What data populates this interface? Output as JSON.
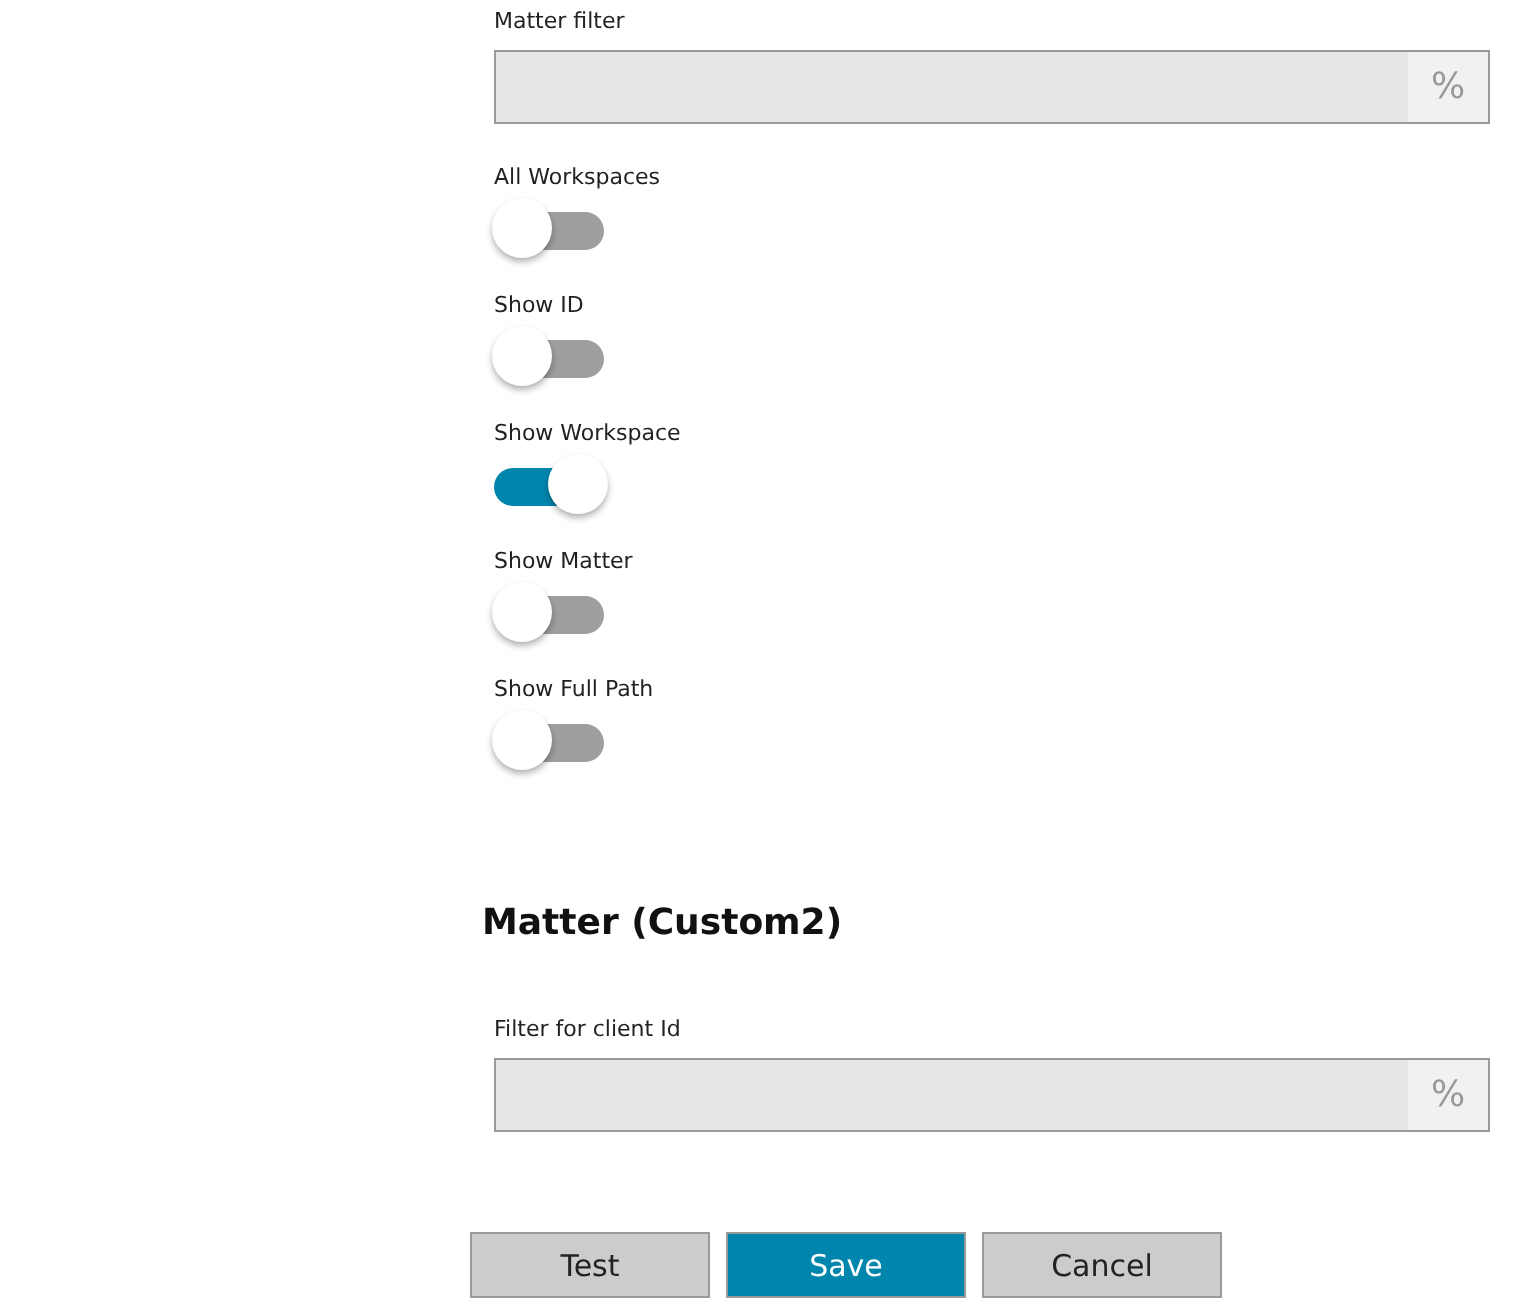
{
  "matter_filter": {
    "label": "Matter filter",
    "suffix": "%"
  },
  "toggles": [
    {
      "label": "All Workspaces",
      "on": false
    },
    {
      "label": "Show ID",
      "on": false
    },
    {
      "label": "Show Workspace",
      "on": true
    },
    {
      "label": "Show Matter",
      "on": false
    },
    {
      "label": "Show Full Path",
      "on": false
    }
  ],
  "section": {
    "title": "Matter (Custom2)",
    "field": {
      "label": "Filter for client Id",
      "suffix": "%"
    }
  },
  "buttons": [
    {
      "label": "Test",
      "kind": "default"
    },
    {
      "label": "Save",
      "kind": "primary"
    },
    {
      "label": "Cancel",
      "kind": "default"
    }
  ]
}
